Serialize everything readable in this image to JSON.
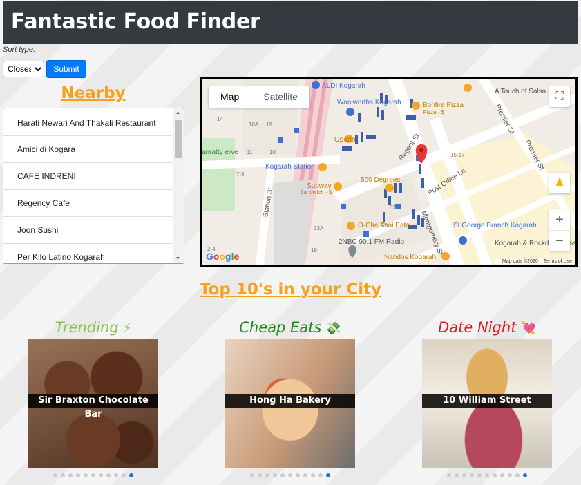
{
  "app": {
    "title": "Fantastic Food Finder"
  },
  "sort": {
    "label": "Sort type:",
    "selected": "Closest",
    "options": [
      "Closest"
    ],
    "submit_label": "Submit"
  },
  "nearby": {
    "title": "Nearby",
    "items": [
      "Harati Newari And Thakali Restaurant",
      "Amici di Kogara",
      "CAFE INDRENI",
      "Regency Cafe",
      "Joon Sushi",
      "Per Kilo Latino Kogarah"
    ]
  },
  "map": {
    "type_map": "Map",
    "type_satellite": "Satellite",
    "labels": {
      "aldi": "ALDI Kogarah",
      "woolworths": "Woolworths Kogarah",
      "bonfire": "Bonfire Pizza",
      "bonfire_sub": "Pizza · $",
      "touch": "A Touch of Salsa",
      "oporto": "Oporto",
      "station": "Kogarah Station",
      "subway": "Subway",
      "subway_sub": "Sandwich · $",
      "degrees": "500 Degrees",
      "ocha": "O-Cha Thai Eate",
      "radio": "2NBC 90.1 FM Radio",
      "nandos": "Nandos Kogarah",
      "stgeorge": "St.George Branch Kogarah",
      "kogarah_rock": "Kogarah & Rockdale Massage",
      "station_st": "Station St",
      "regent_st": "Regent St",
      "premier_st": "Premier St",
      "premier_st2": "Premier St",
      "montgomery": "Montgomery St",
      "post_office": "Post Office Ln",
      "reserve": "anratty erve"
    },
    "google": "Google",
    "map_data": "Map data ©2020",
    "terms": "Terms of Use"
  },
  "top10": {
    "title": "Top 10's in your City",
    "cards": [
      {
        "title": "Trending",
        "emoji": "⚡",
        "caption": "Sir Braxton Chocolate Bar",
        "color": "#8bc34a"
      },
      {
        "title": "Cheap Eats",
        "emoji": "💸",
        "caption": "Hong Ha Bakery",
        "color": "#1a8a1a"
      },
      {
        "title": "Date Night",
        "emoji": "💘",
        "caption": "10 William Street",
        "color": "#e01a1a"
      }
    ]
  }
}
